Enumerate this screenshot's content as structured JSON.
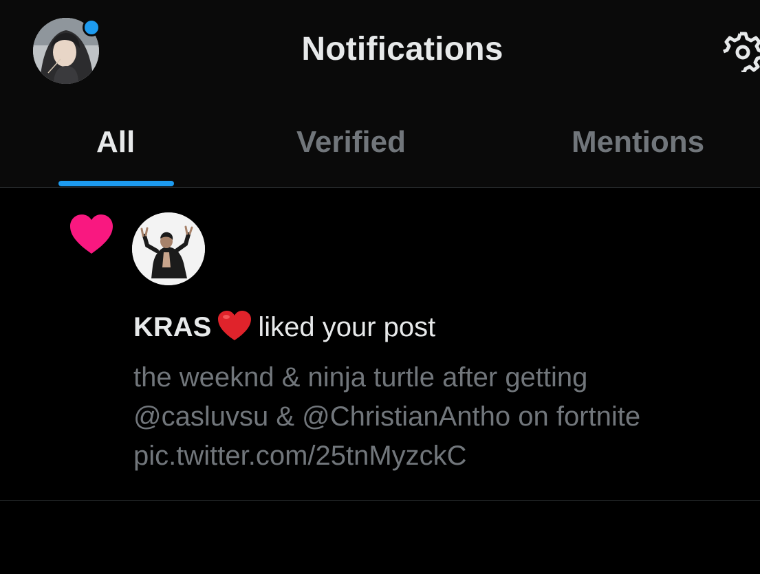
{
  "header": {
    "title": "Notifications",
    "avatar": "user-avatar",
    "settings_icon": "gear-icon",
    "colors": {
      "background": "#0a0a0a",
      "accent": "#1d9bf0"
    }
  },
  "tabs": [
    {
      "label": "All",
      "active": true
    },
    {
      "label": "Verified",
      "active": false
    },
    {
      "label": "Mentions",
      "active": false
    }
  ],
  "notification": {
    "type_icon": "heart-icon",
    "type_icon_color": "#f91880",
    "user_name": "KRAS",
    "name_emoji": "red-heart-emoji",
    "action_text": "liked your post",
    "post_lines": [
      "the weeknd & ninja turtle after getting",
      "@casluvsu & @ChristianAntho on fortnite",
      "pic.twitter.com/25tnMyzckC"
    ]
  }
}
